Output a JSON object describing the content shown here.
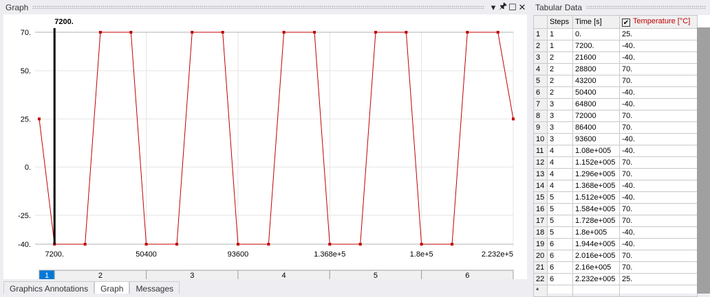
{
  "graph_panel": {
    "title": "Graph",
    "cursor_label": "7200.",
    "tabs": [
      "Graphics Annotations",
      "Graph",
      "Messages"
    ]
  },
  "table_panel": {
    "title": "Tabular Data",
    "headers": [
      "Steps",
      "Time [s]",
      "Temperature [°C]"
    ],
    "new_row_marker": "*",
    "rows": [
      [
        "1",
        "1",
        "0.",
        "25."
      ],
      [
        "2",
        "1",
        "7200.",
        "-40."
      ],
      [
        "3",
        "2",
        "21600",
        "-40."
      ],
      [
        "4",
        "2",
        "28800",
        "70."
      ],
      [
        "5",
        "2",
        "43200",
        "70."
      ],
      [
        "6",
        "2",
        "50400",
        "-40."
      ],
      [
        "7",
        "3",
        "64800",
        "-40."
      ],
      [
        "8",
        "3",
        "72000",
        "70."
      ],
      [
        "9",
        "3",
        "86400",
        "70."
      ],
      [
        "10",
        "3",
        "93600",
        "-40."
      ],
      [
        "11",
        "4",
        "1.08e+005",
        "-40."
      ],
      [
        "12",
        "4",
        "1.152e+005",
        "70."
      ],
      [
        "13",
        "4",
        "1.296e+005",
        "70."
      ],
      [
        "14",
        "4",
        "1.368e+005",
        "-40."
      ],
      [
        "15",
        "5",
        "1.512e+005",
        "-40."
      ],
      [
        "16",
        "5",
        "1.584e+005",
        "70."
      ],
      [
        "17",
        "5",
        "1.728e+005",
        "70."
      ],
      [
        "18",
        "5",
        "1.8e+005",
        "-40."
      ],
      [
        "19",
        "6",
        "1.944e+005",
        "-40."
      ],
      [
        "20",
        "6",
        "2.016e+005",
        "70."
      ],
      [
        "21",
        "6",
        "2.16e+005",
        "70."
      ],
      [
        "22",
        "6",
        "2.232e+005",
        "25."
      ]
    ]
  },
  "chart_data": {
    "type": "line",
    "title": "",
    "xlabel": "Time [s]",
    "ylabel": "Temperature [°C]",
    "x": [
      0,
      7200,
      21600,
      28800,
      43200,
      50400,
      64800,
      72000,
      86400,
      93600,
      108000,
      115200,
      129600,
      136800,
      151200,
      158400,
      172800,
      180000,
      194400,
      201600,
      216000,
      223200
    ],
    "y": [
      25,
      -40,
      -40,
      70,
      70,
      -40,
      -40,
      70,
      70,
      -40,
      -40,
      70,
      70,
      -40,
      -40,
      70,
      70,
      -40,
      -40,
      70,
      70,
      25
    ],
    "xlim": [
      0,
      223200
    ],
    "ylim": [
      -40,
      70
    ],
    "yticks": [
      "70.",
      "50.",
      "25.",
      "0.",
      "-25.",
      "-40."
    ],
    "ytick_values": [
      70,
      50,
      25,
      0,
      -25,
      -40
    ],
    "xticks": [
      "7200.",
      "50400",
      "93600",
      "1.368e+5",
      "1.8e+5",
      "2.232e+5"
    ],
    "xtick_values": [
      7200,
      50400,
      93600,
      136800,
      180000,
      223200
    ],
    "steps": [
      "1",
      "2",
      "3",
      "4",
      "5",
      "6"
    ],
    "step_ends": [
      7200,
      50400,
      93600,
      136800,
      180000,
      223200
    ],
    "active_step": "1",
    "cursor_x": 7200,
    "series_color": "#c00000"
  }
}
